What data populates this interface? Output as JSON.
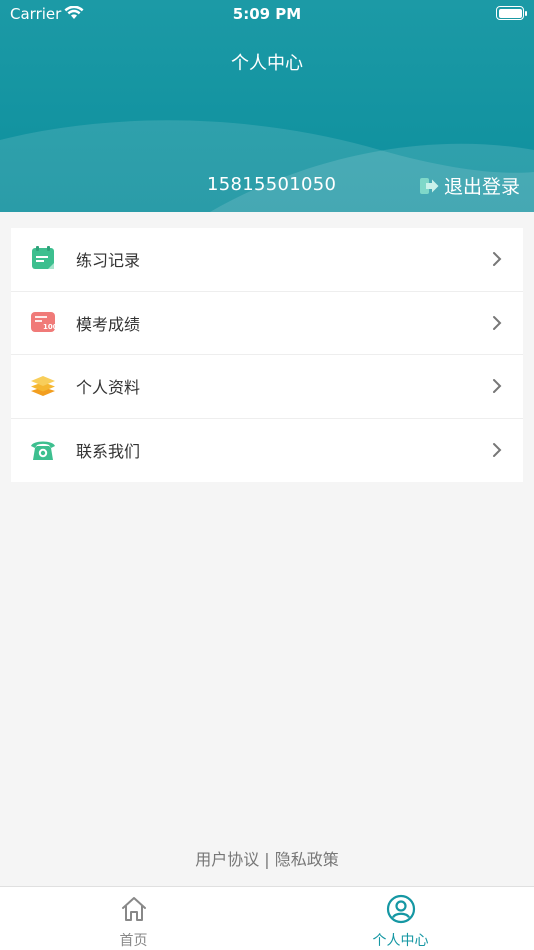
{
  "status_bar": {
    "carrier": "Carrier",
    "time": "5:09 PM"
  },
  "header": {
    "title": "个人中心",
    "phone": "15815501050",
    "logout_label": "退出登录"
  },
  "menu": {
    "items": [
      {
        "label": "练习记录",
        "icon": "practice-record-icon"
      },
      {
        "label": "模考成绩",
        "icon": "exam-score-icon"
      },
      {
        "label": "个人资料",
        "icon": "profile-layers-icon"
      },
      {
        "label": "联系我们",
        "icon": "phone-icon"
      }
    ]
  },
  "footer": {
    "user_agreement": "用户协议",
    "separator": " | ",
    "privacy_policy": "隐私政策"
  },
  "tabbar": {
    "home_label": "首页",
    "profile_label": "个人中心",
    "active": "profile"
  },
  "colors": {
    "brand": "#1597a3",
    "green": "#3dbf8f",
    "pink": "#f07a78",
    "amber": "#f5b731"
  }
}
